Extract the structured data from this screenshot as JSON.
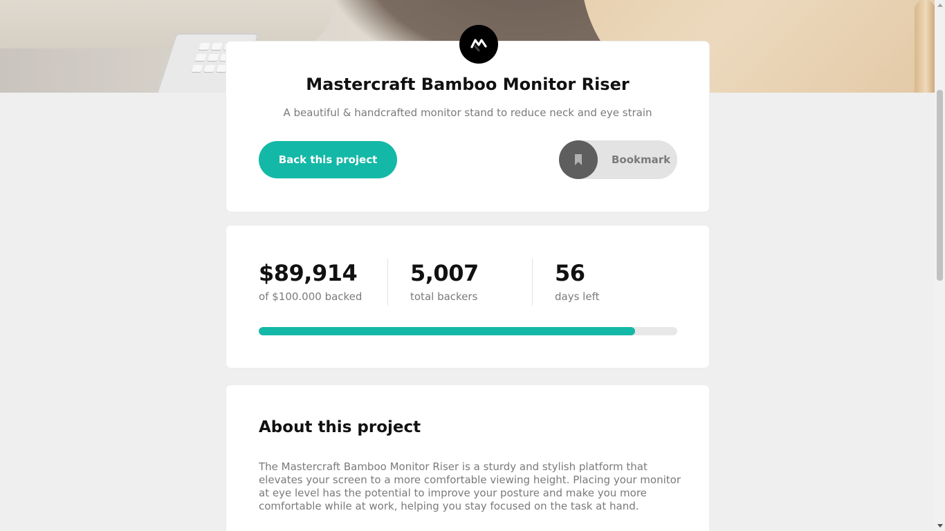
{
  "hero": {
    "image": "bamboo-monitor-riser-photo"
  },
  "project": {
    "logo_icon": "mastercraft-logo-icon",
    "title": "Mastercraft Bamboo Monitor Riser",
    "subtitle": "A beautiful & handcrafted monitor stand to reduce neck and eye strain",
    "back_label": "Back this project",
    "bookmark_label": "Bookmark",
    "bookmark_icon": "bookmark-icon"
  },
  "stats": {
    "backed_amount": "$89,914",
    "backed_label": "of $100.000 backed",
    "backers_count": "5,007",
    "backers_label": "total backers",
    "days_count": "56",
    "days_label": "days left",
    "progress_fraction": 0.89914
  },
  "about": {
    "title": "About this project",
    "paragraph": "The Mastercraft Bamboo Monitor Riser is a sturdy and stylish platform that elevates your screen to a more comfortable viewing height. Placing your monitor at eye level has the potential to improve your posture and make you more comfortable while at work, helping you stay focused on the task at hand."
  },
  "colors": {
    "accent": "#14b8a6",
    "background": "#efefef",
    "muted_text": "#7a7a7a"
  }
}
